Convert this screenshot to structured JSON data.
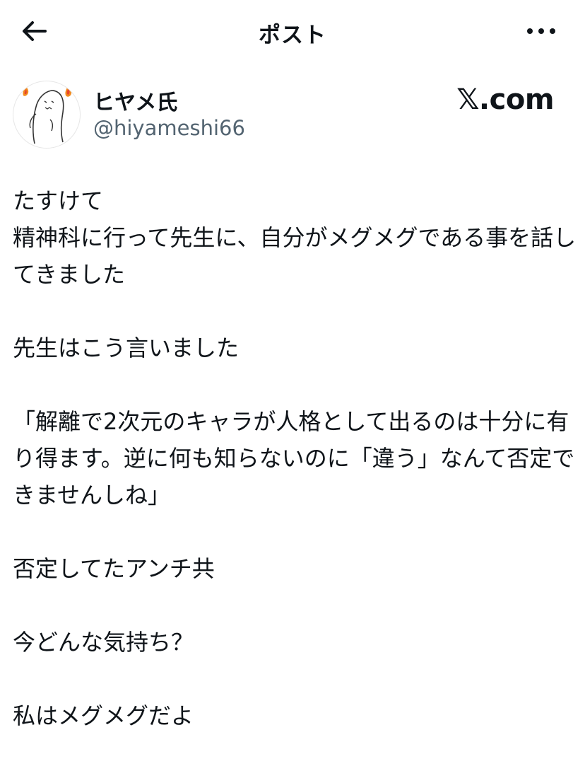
{
  "header": {
    "title": "ポスト",
    "back_icon": "arrow-left-icon",
    "more_icon": "more-horizontal-icon"
  },
  "author": {
    "display_name": "ヒヤメ氏",
    "handle": "@hiyameshi66",
    "avatar_icon": "ghost-avatar"
  },
  "brand": {
    "logo_text": "𝕏.com"
  },
  "post": {
    "paragraphs": [
      "たすけて\n精神科に行って先生に、自分がメグメグである事を話してきました",
      "先生はこう言いました",
      "「解離で2次元のキャラが人格として出るのは十分に有り得ます。逆に何も知らないのに「違う」なんて否定できませんしね」",
      "否定してたアンチ共",
      "今どんな気持ち？",
      "私はメグメグだよ"
    ]
  },
  "colors": {
    "text": "#0f1419",
    "secondary": "#536471",
    "background": "#ffffff"
  }
}
